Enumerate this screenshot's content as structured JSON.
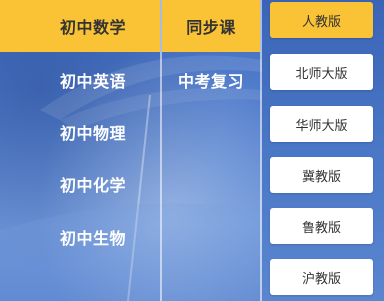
{
  "subjects": {
    "items": [
      {
        "label": "初中数学"
      },
      {
        "label": "初中英语"
      },
      {
        "label": "初中物理"
      },
      {
        "label": "初中化学"
      },
      {
        "label": "初中生物"
      }
    ]
  },
  "categories": {
    "items": [
      {
        "label": "同步课"
      },
      {
        "label": "中考复习"
      }
    ]
  },
  "versions": {
    "items": [
      {
        "label": "人教版"
      },
      {
        "label": "北师大版"
      },
      {
        "label": "华师大版"
      },
      {
        "label": "冀教版"
      },
      {
        "label": "鲁教版"
      },
      {
        "label": "沪教版"
      }
    ]
  },
  "colors": {
    "active": "#f9c335",
    "panel_blue": "#4a74bf",
    "text_white": "#ffffff",
    "text_dark": "#333333"
  }
}
